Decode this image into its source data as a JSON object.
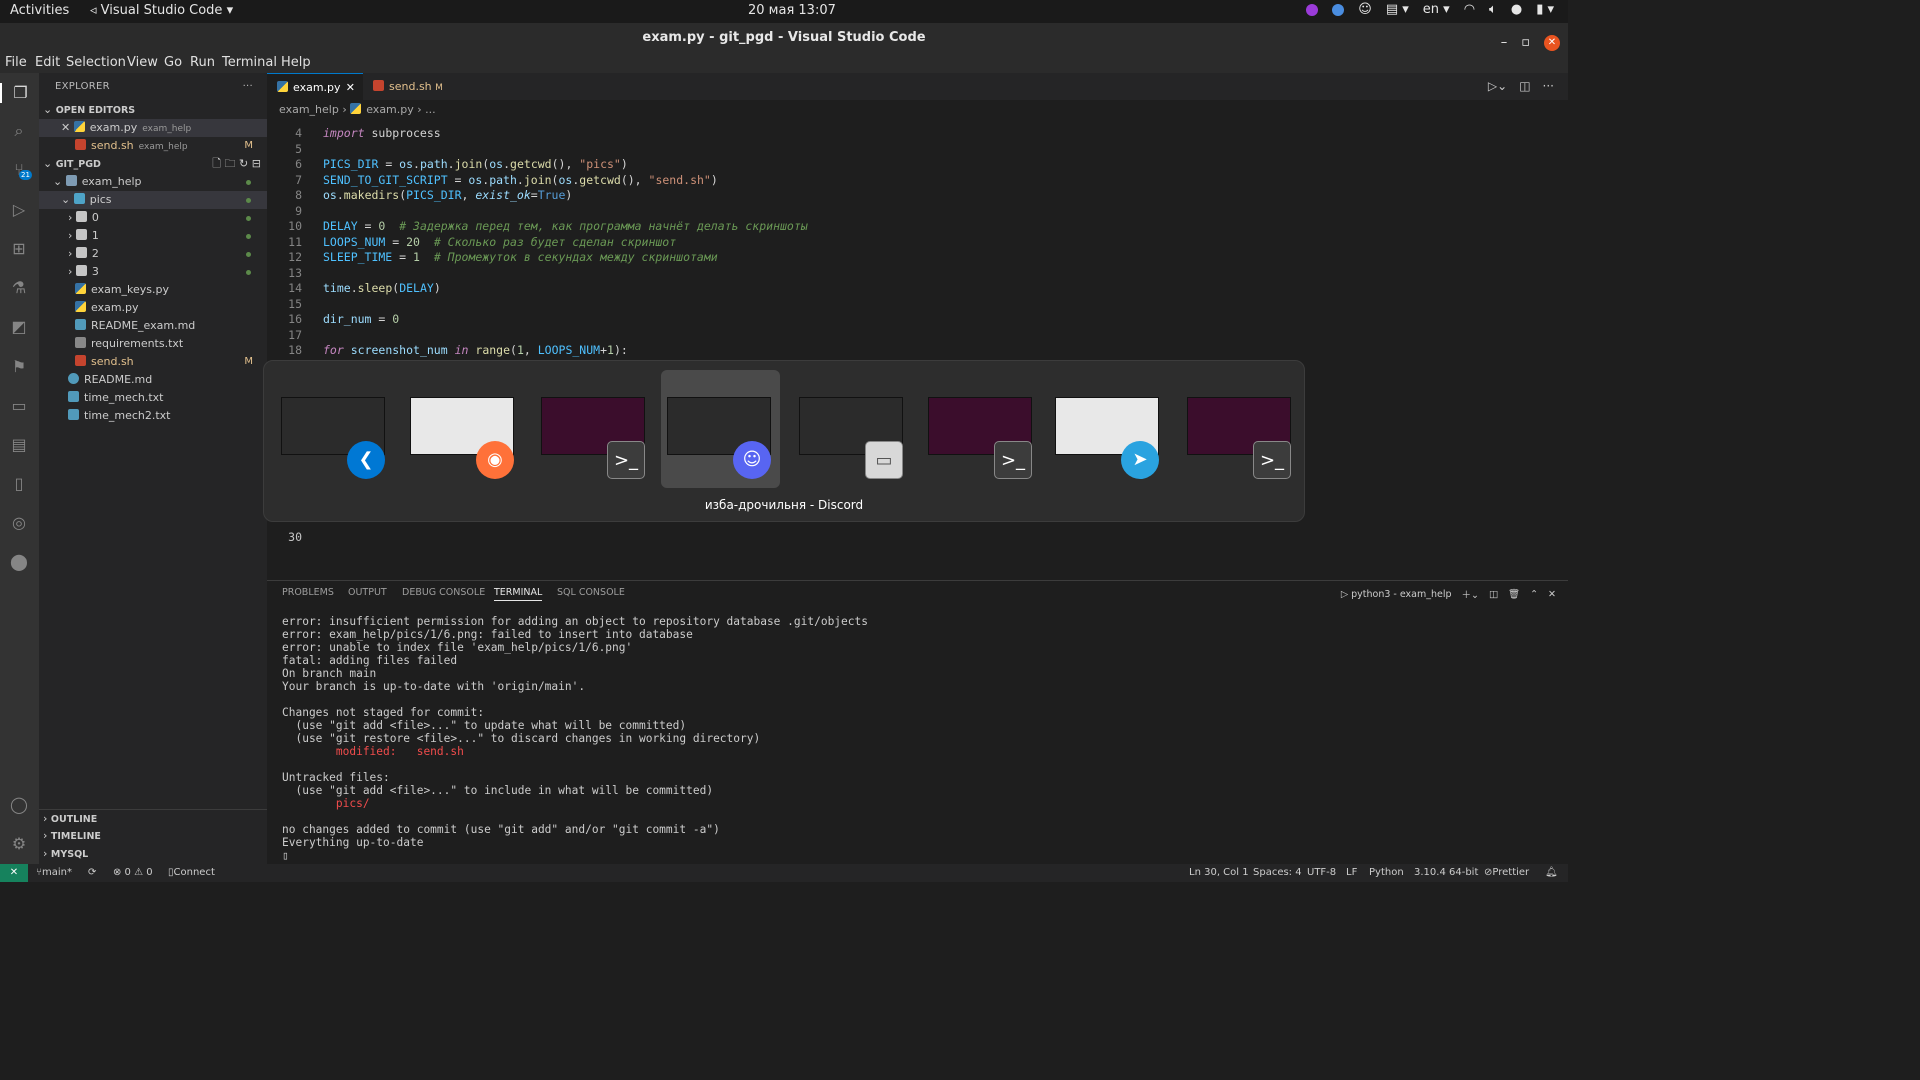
{
  "gnome_topbar": {
    "activities": "Activities",
    "app_name": "Visual Studio Code",
    "clock": "20 мая  13:07",
    "lang": "en"
  },
  "window": {
    "title": "exam.py - git_pgd - Visual Studio Code"
  },
  "menu": [
    "File",
    "Edit",
    "Selection",
    "View",
    "Go",
    "Run",
    "Terminal",
    "Help"
  ],
  "sidebar": {
    "title": "EXPLORER",
    "open_editors_title": "OPEN EDITORS",
    "open_editors": [
      {
        "name": "exam.py",
        "folder": "exam_help",
        "mark": ""
      },
      {
        "name": "send.sh",
        "folder": "exam_help",
        "mark": "M"
      }
    ],
    "workspace_title": "GIT_PGD",
    "tree": [
      {
        "name": "exam_help",
        "type": "folder-open"
      },
      {
        "name": "pics",
        "type": "folder-open"
      },
      {
        "name": "0",
        "type": "folder"
      },
      {
        "name": "1",
        "type": "folder"
      },
      {
        "name": "2",
        "type": "folder"
      },
      {
        "name": "3",
        "type": "folder"
      },
      {
        "name": "exam_keys.py",
        "type": "python"
      },
      {
        "name": "exam.py",
        "type": "python"
      },
      {
        "name": "README_exam.md",
        "type": "markdown"
      },
      {
        "name": "requirements.txt",
        "type": "text"
      },
      {
        "name": "send.sh",
        "type": "shell",
        "mark": "M"
      },
      {
        "name": "README.md",
        "type": "info"
      },
      {
        "name": "time_mech.txt",
        "type": "text"
      },
      {
        "name": "time_mech2.txt",
        "type": "text"
      }
    ],
    "sections": [
      "OUTLINE",
      "TIMELINE",
      "MYSQL"
    ],
    "scm_badge": "21"
  },
  "tabs": [
    {
      "label": "exam.py",
      "active": true
    },
    {
      "label": "send.sh",
      "modified": "M",
      "active": false
    }
  ],
  "breadcrumb": [
    "exam_help",
    "exam.py",
    "..."
  ],
  "editor": {
    "lines": [
      {
        "n": "4",
        "html": "<span class='kw'>import</span> subprocess"
      },
      {
        "n": "5",
        "html": ""
      },
      {
        "n": "6",
        "html": "<span class='cn'>PICS_DIR</span> = <span class='vr'>os</span>.<span class='vr'>path</span>.<span class='fn'>join</span>(<span class='vr'>os</span>.<span class='fn'>getcwd</span>(), <span class='str'>\"pics\"</span>)"
      },
      {
        "n": "7",
        "html": "<span class='cn'>SEND_TO_GIT_SCRIPT</span> = <span class='vr'>os</span>.<span class='vr'>path</span>.<span class='fn'>join</span>(<span class='vr'>os</span>.<span class='fn'>getcwd</span>(), <span class='str'>\"send.sh\"</span>)"
      },
      {
        "n": "8",
        "html": "<span class='vr'>os</span>.<span class='fn'>makedirs</span>(<span class='cn'>PICS_DIR</span>, <span class='prm'>exist_ok</span>=<span class='kw' style='font-style:normal;color:#569cd6'>True</span>)"
      },
      {
        "n": "9",
        "html": ""
      },
      {
        "n": "10",
        "html": "<span class='cn'>DELAY</span> = <span class='num'>0</span>  <span class='cm'># Задержка перед тем, как программа начнёт делать скриншоты</span>"
      },
      {
        "n": "11",
        "html": "<span class='cn'>LOOPS_NUM</span> = <span class='num'>20</span>  <span class='cm'># Сколько раз будет сделан скриншот</span>"
      },
      {
        "n": "12",
        "html": "<span class='cn'>SLEEP_TIME</span> = <span class='num'>1</span>  <span class='cm'># Промежуток в секундах между скриншотами</span>"
      },
      {
        "n": "13",
        "html": ""
      },
      {
        "n": "14",
        "html": "<span class='vr'>time</span>.<span class='fn'>sleep</span>(<span class='cn'>DELAY</span>)"
      },
      {
        "n": "15",
        "html": ""
      },
      {
        "n": "16",
        "html": "<span class='vr'>dir_num</span> = <span class='num'>0</span>"
      },
      {
        "n": "17",
        "html": ""
      },
      {
        "n": "18",
        "html": "<span class='kw'>for</span> <span class='vr'>screenshot_num</span> <span class='kw'>in</span> <span class='fn'>range</span>(<span class='num'>1</span>, <span class='cn'>LOOPS_NUM</span>+<span class='num'>1</span>):"
      }
    ],
    "last_line": "30"
  },
  "switcher": {
    "caption": "изба-дрочильня - Discord",
    "apps": [
      {
        "name": "vscode-icon",
        "color": "#0078d4",
        "glyph": "❮"
      },
      {
        "name": "firefox-icon",
        "color": "#ff7139",
        "glyph": "◉"
      },
      {
        "name": "terminal-icon",
        "color": "#3c3c3c",
        "glyph": ">_"
      },
      {
        "name": "discord-icon",
        "color": "#5865f2",
        "glyph": "☺"
      },
      {
        "name": "files-icon",
        "color": "#d8d8d8",
        "glyph": "▭"
      },
      {
        "name": "terminal-icon",
        "color": "#3c3c3c",
        "glyph": ">_"
      },
      {
        "name": "telegram-icon",
        "color": "#2aa3e0",
        "glyph": "➤"
      },
      {
        "name": "terminal-icon",
        "color": "#3c3c3c",
        "glyph": ">_"
      }
    ]
  },
  "panel": {
    "tabs": [
      "PROBLEMS",
      "OUTPUT",
      "DEBUG CONSOLE",
      "TERMINAL",
      "SQL CONSOLE"
    ],
    "active_tab": "TERMINAL",
    "terminal_name": "python3 - exam_help",
    "output": [
      {
        "t": "error: insufficient permission for adding an object to repository database .git/objects"
      },
      {
        "t": "error: exam_help/pics/1/6.png: failed to insert into database"
      },
      {
        "t": "error: unable to index file 'exam_help/pics/1/6.png'"
      },
      {
        "t": "fatal: adding files failed"
      },
      {
        "t": "On branch main"
      },
      {
        "t": "Your branch is up-to-date with 'origin/main'."
      },
      {
        "t": ""
      },
      {
        "t": "Changes not staged for commit:"
      },
      {
        "t": "  (use \"git add <file>...\" to update what will be committed)"
      },
      {
        "t": "  (use \"git restore <file>...\" to discard changes in working directory)"
      },
      {
        "t": "        modified:   send.sh",
        "red": true
      },
      {
        "t": ""
      },
      {
        "t": "Untracked files:"
      },
      {
        "t": "  (use \"git add <file>...\" to include in what will be committed)"
      },
      {
        "t": "        pics/",
        "red": true
      },
      {
        "t": ""
      },
      {
        "t": "no changes added to commit (use \"git add\" and/or \"git commit -a\")"
      },
      {
        "t": "Everything up-to-date"
      }
    ]
  },
  "status": {
    "branch": "main*",
    "problems": "⊗ 0 ⚠ 0",
    "connect": "Connect",
    "position": "Ln 30, Col 1",
    "spaces": "Spaces: 4",
    "encoding": "UTF-8",
    "eol": "LF",
    "language": "Python",
    "interpreter": "3.10.4 64-bit",
    "prettier": "Prettier"
  }
}
